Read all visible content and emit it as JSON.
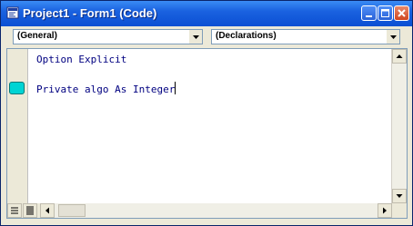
{
  "window": {
    "title": "Project1 - Form1 (Code)"
  },
  "titlebar_buttons": [
    "minimize-icon",
    "maximize-icon",
    "close-icon"
  ],
  "object_combo": {
    "selected": "(General)"
  },
  "procedure_combo": {
    "selected": "(Declarations)"
  },
  "code": {
    "lines": [
      "Option Explicit",
      "",
      "Private algo As Integer"
    ]
  },
  "colors": {
    "title_bar": "#0b4fd3",
    "code_text": "#000080",
    "breakpoint_marker": "#00d4d4"
  }
}
